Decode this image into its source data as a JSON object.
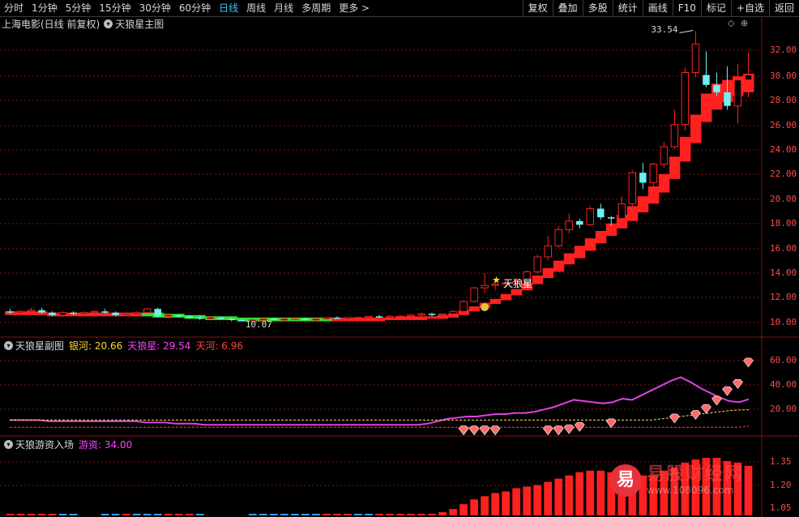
{
  "toolbar": {
    "periods": [
      "分时",
      "1分钟",
      "5分钟",
      "15分钟",
      "30分钟",
      "60分钟",
      "日线",
      "周线",
      "月线",
      "多周期",
      "更多 >"
    ],
    "active_index": 6,
    "right_buttons": [
      "复权",
      "叠加",
      "多股",
      "统计",
      "画线",
      "F10",
      "标记",
      "+自选",
      "返回"
    ]
  },
  "main_panel": {
    "stock_title": "上海电影(日线 前复权)",
    "indicator_name": "天狼星主图",
    "y_labels": [
      "32.00",
      "30.00",
      "28.00",
      "26.00",
      "24.00",
      "22.00",
      "20.00",
      "18.00",
      "16.00",
      "14.00",
      "12.00",
      "10.00"
    ],
    "high_label": "33.54",
    "low_label": "10.07",
    "signal_label": "天狼星",
    "corner_icons": [
      "◇",
      "⊕"
    ]
  },
  "sub_panel": {
    "name": "天狼星副图",
    "yinhe_label": "银河: 20.66",
    "tianlang_label": "天狼星: 29.54",
    "tianhe_label": "天河: 6.96",
    "y_labels": [
      "60.00",
      "40.00",
      "20.00"
    ]
  },
  "bottom_panel": {
    "name": "天狼游资入场",
    "youzi_label": "游资: 34.00",
    "y_labels": [
      "1.35",
      "1.20",
      "1.05"
    ]
  },
  "watermark": {
    "logo_char": "易",
    "big_text": "易股财经网",
    "url": "www.108096.com"
  },
  "colors": {
    "red": "#ff2020",
    "cyan": "#70f0f0",
    "magenta": "#e040e0",
    "yellow": "#ffe060",
    "green": "#30e030",
    "blue": "#3a9cff",
    "grid": "#8a1010"
  },
  "chart_data": [
    {
      "type": "candlestick",
      "title": "天狼星主图",
      "ylim": [
        9.5,
        34
      ],
      "candles_ohlc": [
        [
          10.9,
          11.1,
          10.7,
          10.8
        ],
        [
          10.8,
          11.0,
          10.6,
          10.9
        ],
        [
          10.9,
          11.2,
          10.8,
          11.0
        ],
        [
          11.0,
          11.2,
          10.7,
          10.8
        ],
        [
          10.8,
          10.9,
          10.5,
          10.6
        ],
        [
          10.6,
          10.9,
          10.5,
          10.8
        ],
        [
          10.8,
          10.9,
          10.6,
          10.7
        ],
        [
          10.7,
          10.9,
          10.6,
          10.8
        ],
        [
          10.8,
          11.0,
          10.7,
          10.9
        ],
        [
          10.9,
          11.1,
          10.7,
          10.8
        ],
        [
          10.8,
          10.9,
          10.5,
          10.6
        ],
        [
          10.6,
          10.8,
          10.5,
          10.7
        ],
        [
          10.7,
          10.9,
          10.6,
          10.8
        ],
        [
          10.8,
          11.2,
          10.7,
          11.1
        ],
        [
          11.1,
          11.2,
          10.4,
          10.5
        ],
        [
          10.5,
          10.7,
          10.3,
          10.6
        ],
        [
          10.6,
          10.7,
          10.4,
          10.5
        ],
        [
          10.5,
          10.6,
          10.3,
          10.4
        ],
        [
          10.4,
          10.6,
          10.2,
          10.3
        ],
        [
          10.3,
          10.5,
          10.2,
          10.4
        ],
        [
          10.4,
          10.5,
          10.2,
          10.3
        ],
        [
          10.3,
          10.4,
          10.1,
          10.2
        ],
        [
          10.2,
          10.3,
          10.07,
          10.1
        ],
        [
          10.1,
          10.3,
          10.0,
          10.2
        ],
        [
          10.2,
          10.3,
          10.1,
          10.3
        ],
        [
          10.3,
          10.4,
          10.2,
          10.2
        ],
        [
          10.2,
          10.3,
          10.1,
          10.3
        ],
        [
          10.3,
          10.4,
          10.2,
          10.3
        ],
        [
          10.3,
          10.4,
          10.2,
          10.2
        ],
        [
          10.2,
          10.3,
          10.1,
          10.3
        ],
        [
          10.3,
          10.4,
          10.2,
          10.4
        ],
        [
          10.4,
          10.5,
          10.3,
          10.3
        ],
        [
          10.3,
          10.4,
          10.2,
          10.4
        ],
        [
          10.4,
          10.5,
          10.3,
          10.4
        ],
        [
          10.4,
          10.5,
          10.3,
          10.5
        ],
        [
          10.5,
          10.6,
          10.4,
          10.4
        ],
        [
          10.4,
          10.6,
          10.3,
          10.5
        ],
        [
          10.5,
          10.6,
          10.4,
          10.5
        ],
        [
          10.5,
          10.7,
          10.4,
          10.6
        ],
        [
          10.6,
          10.8,
          10.5,
          10.7
        ],
        [
          10.7,
          10.8,
          10.5,
          10.6
        ],
        [
          10.6,
          10.7,
          10.5,
          10.7
        ],
        [
          10.7,
          11.0,
          10.6,
          10.9
        ],
        [
          10.9,
          11.8,
          10.8,
          11.7
        ],
        [
          11.7,
          12.9,
          11.6,
          12.8
        ],
        [
          12.8,
          14.0,
          12.4,
          13.0
        ],
        [
          13.0,
          13.3,
          12.6,
          13.1
        ],
        [
          13.1,
          13.5,
          12.8,
          13.2
        ],
        [
          13.2,
          13.6,
          13.0,
          13.3
        ],
        [
          13.3,
          14.2,
          13.1,
          14.1
        ],
        [
          14.1,
          15.5,
          13.9,
          15.3
        ],
        [
          15.3,
          17.0,
          15.0,
          16.2
        ],
        [
          16.2,
          17.8,
          16.0,
          17.5
        ],
        [
          17.5,
          18.8,
          17.2,
          18.2
        ],
        [
          18.2,
          18.4,
          17.6,
          17.9
        ],
        [
          17.9,
          19.4,
          17.8,
          19.2
        ],
        [
          19.2,
          19.6,
          18.3,
          18.5
        ],
        [
          18.5,
          18.6,
          17.8,
          18.4
        ],
        [
          18.4,
          20.2,
          18.2,
          19.6
        ],
        [
          19.6,
          22.3,
          19.3,
          22.1
        ],
        [
          22.1,
          22.9,
          20.8,
          21.3
        ],
        [
          21.3,
          22.9,
          21.0,
          22.8
        ],
        [
          22.8,
          24.6,
          22.5,
          24.2
        ],
        [
          24.2,
          27.2,
          24.0,
          26.0
        ],
        [
          26.0,
          30.6,
          25.5,
          30.2
        ],
        [
          30.2,
          33.54,
          29.8,
          32.5
        ],
        [
          30.0,
          31.9,
          29.0,
          29.2
        ],
        [
          29.2,
          30.2,
          28.3,
          28.6
        ],
        [
          28.6,
          30.7,
          27.2,
          27.5
        ],
        [
          27.5,
          30.9,
          26.1,
          29.6
        ],
        [
          29.6,
          31.8,
          28.2,
          30.0
        ]
      ],
      "band_upper": [
        10.9,
        10.9,
        10.9,
        10.9,
        10.8,
        10.8,
        10.8,
        10.8,
        10.8,
        10.8,
        10.8,
        10.8,
        10.8,
        10.8,
        10.8,
        10.7,
        10.7,
        10.6,
        10.6,
        10.5,
        10.5,
        10.5,
        10.4,
        10.4,
        10.4,
        10.4,
        10.4,
        10.4,
        10.4,
        10.4,
        10.4,
        10.4,
        10.4,
        10.4,
        10.4,
        10.4,
        10.4,
        10.5,
        10.5,
        10.5,
        10.5,
        10.6,
        10.7,
        11.0,
        11.3,
        11.6,
        11.9,
        12.3,
        12.7,
        13.2,
        13.8,
        14.4,
        15.0,
        15.6,
        16.2,
        16.8,
        17.4,
        18.0,
        18.7,
        19.4,
        20.2,
        21.0,
        22.0,
        23.4,
        25.0,
        26.8,
        28.5,
        29.3,
        29.6,
        29.9,
        30.1
      ],
      "band_lower": [
        10.6,
        10.6,
        10.6,
        10.6,
        10.5,
        10.5,
        10.5,
        10.5,
        10.5,
        10.5,
        10.5,
        10.5,
        10.5,
        10.5,
        10.4,
        10.4,
        10.4,
        10.3,
        10.3,
        10.2,
        10.2,
        10.2,
        10.1,
        10.1,
        10.1,
        10.1,
        10.1,
        10.1,
        10.1,
        10.1,
        10.1,
        10.1,
        10.1,
        10.1,
        10.1,
        10.1,
        10.2,
        10.2,
        10.2,
        10.2,
        10.3,
        10.3,
        10.4,
        10.6,
        10.9,
        11.2,
        11.5,
        11.8,
        12.2,
        12.6,
        13.1,
        13.6,
        14.1,
        14.7,
        15.2,
        15.8,
        16.4,
        17.0,
        17.6,
        18.2,
        18.9,
        19.6,
        20.5,
        21.6,
        23.0,
        24.5,
        26.2,
        27.2,
        27.8,
        28.3,
        28.6
      ],
      "band_green_range": [
        13,
        30
      ]
    },
    {
      "type": "line",
      "title": "天狼星副图",
      "ylim": [
        0,
        66
      ],
      "series": [
        {
          "name": "天狼星",
          "color": "#e040e0",
          "values": [
            12,
            12,
            12,
            12,
            11,
            11,
            11,
            11,
            11,
            11,
            11,
            11,
            11,
            11,
            10,
            10,
            10,
            9,
            9,
            9,
            8,
            8,
            8,
            8,
            8,
            8,
            8,
            8,
            8,
            8,
            8,
            8,
            8,
            8,
            8,
            8,
            8,
            8,
            8,
            8,
            8,
            8,
            8,
            9,
            11,
            13,
            14,
            15,
            15,
            16,
            17,
            17,
            18,
            18,
            19,
            21,
            23,
            26,
            29,
            28,
            27,
            26,
            27,
            30,
            29,
            33,
            37,
            41,
            45,
            48,
            44,
            39,
            35,
            31,
            28,
            27,
            29.54
          ]
        },
        {
          "name": "银河",
          "color": "#ffe060",
          "values": [
            12,
            12,
            12,
            12,
            12,
            12,
            12,
            12,
            12,
            12,
            12,
            12,
            12,
            12,
            12,
            12,
            12,
            12,
            12,
            12,
            12,
            12,
            12,
            12,
            12,
            12,
            12,
            12,
            12,
            12,
            12,
            12,
            12,
            12,
            12,
            12,
            12,
            12,
            12,
            12,
            12,
            12,
            12,
            12,
            12,
            12,
            12,
            12,
            12,
            12,
            12,
            12,
            12,
            12,
            12,
            12,
            12,
            12,
            12,
            12,
            12,
            12,
            12,
            12,
            12,
            12,
            12,
            13,
            14,
            15,
            16,
            17,
            18,
            19,
            20,
            20.5,
            20.66
          ]
        },
        {
          "name": "天河",
          "color": "#ff4040",
          "values": [
            6,
            6,
            6,
            6,
            6,
            6,
            6,
            6,
            6,
            6,
            6,
            6,
            6,
            6,
            6,
            6,
            6,
            6,
            6,
            6,
            6,
            6,
            6,
            6,
            6,
            6,
            6,
            6,
            6,
            6,
            6,
            6,
            6,
            6,
            6,
            6,
            6,
            6,
            6,
            6,
            6,
            6,
            6,
            6,
            6,
            6,
            6,
            6,
            6,
            6,
            6,
            6,
            6,
            6,
            6,
            6,
            6,
            6,
            6,
            6,
            6,
            6,
            6,
            6,
            6,
            6,
            6,
            6,
            6,
            6,
            6,
            6,
            6,
            6,
            6,
            6,
            6.96
          ]
        }
      ],
      "gem_markers": [
        [
          43,
          3
        ],
        [
          44,
          3
        ],
        [
          45,
          3
        ],
        [
          46,
          3
        ],
        [
          51,
          3
        ],
        [
          52,
          3
        ],
        [
          53,
          4
        ],
        [
          54,
          6
        ],
        [
          57,
          9
        ],
        [
          63,
          13
        ],
        [
          65,
          16
        ],
        [
          66,
          21
        ],
        [
          67,
          28
        ],
        [
          68,
          36
        ],
        [
          69,
          42
        ],
        [
          70,
          60
        ]
      ]
    },
    {
      "type": "bar",
      "title": "天狼游资入场",
      "ylim": [
        1.02,
        1.42
      ],
      "values": [
        1.03,
        1.03,
        1.03,
        1.03,
        1.03,
        1.03,
        1.03,
        0,
        0,
        1.03,
        1.03,
        1.03,
        1.03,
        1.03,
        1.03,
        1.03,
        1.03,
        1.03,
        1.03,
        0,
        0,
        0,
        0,
        1.03,
        1.03,
        1.03,
        1.03,
        1.03,
        1.03,
        1.03,
        1.03,
        1.03,
        1.03,
        1.03,
        1.03,
        1.03,
        1.03,
        1.03,
        1.03,
        1.03,
        1.03,
        1.04,
        1.06,
        1.09,
        1.12,
        1.14,
        1.16,
        1.17,
        1.19,
        1.2,
        1.21,
        1.23,
        1.25,
        1.27,
        1.29,
        1.3,
        1.3,
        1.29,
        1.29,
        1.27,
        1.27,
        1.27,
        1.3,
        1.32,
        1.35,
        1.37,
        1.38,
        1.38,
        1.36,
        1.35,
        1.33
      ],
      "bar_colors": [
        "r",
        "r",
        "r",
        "r",
        "r",
        "b",
        "b",
        "",
        "",
        "b",
        "b",
        "r",
        "b",
        "b",
        "b",
        "r",
        "r",
        "r",
        "b",
        "",
        "",
        "",
        "",
        "b",
        "b",
        "b",
        "b",
        "b",
        "b",
        "b",
        "r",
        "r",
        "r",
        "b",
        "b",
        "r",
        "r",
        "r",
        "r",
        "r",
        "r",
        "r",
        "r",
        "r",
        "r",
        "r",
        "r",
        "r",
        "r",
        "r",
        "r",
        "r",
        "r",
        "r",
        "r",
        "r",
        "r",
        "r",
        "r",
        "r",
        "r",
        "r",
        "r",
        "r",
        "r",
        "r",
        "r",
        "r",
        "r",
        "r",
        "r"
      ]
    }
  ]
}
